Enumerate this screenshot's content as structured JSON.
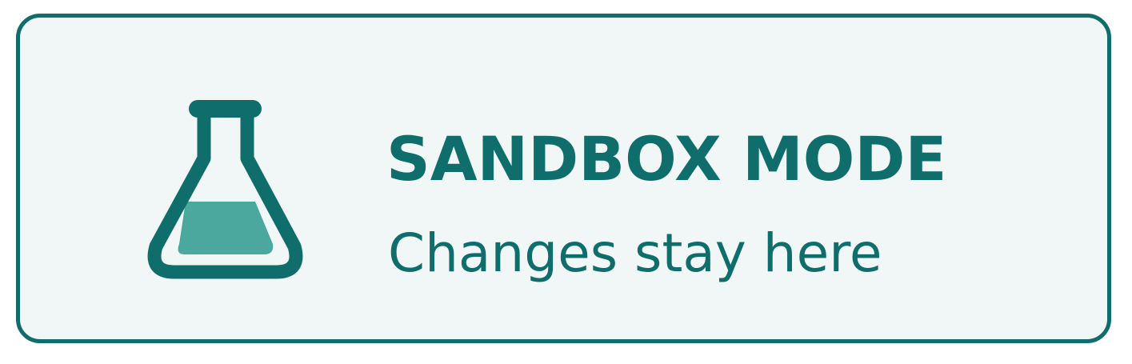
{
  "banner": {
    "icon": "flask-icon",
    "title": "SANDBOX MODE",
    "subtitle": "Changes stay here"
  },
  "colors": {
    "accent": "#0f6e6c",
    "liquid": "#4aa89e",
    "background": "#f1f7f7"
  }
}
